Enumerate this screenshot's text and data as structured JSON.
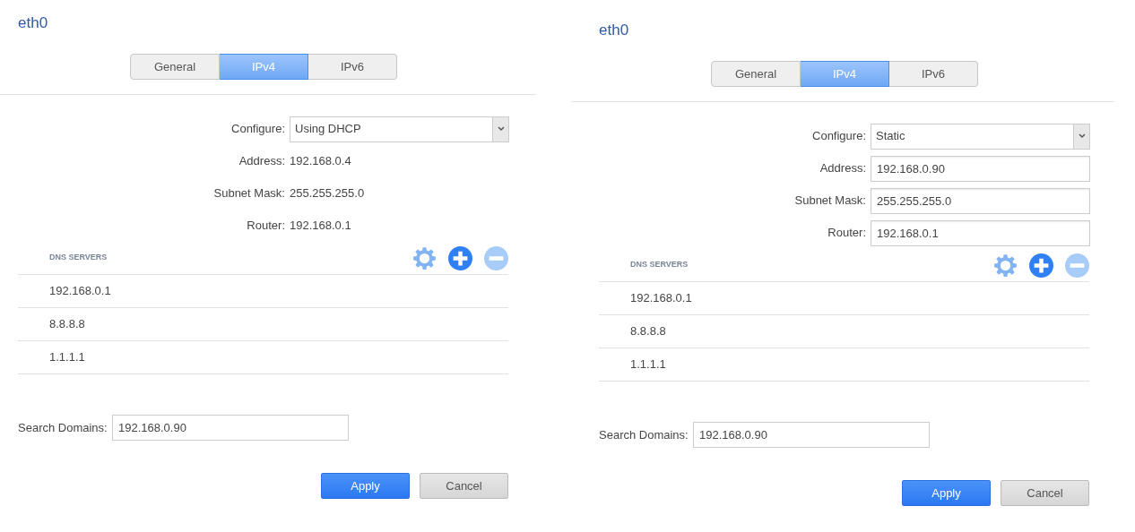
{
  "panels": [
    {
      "title": "eth0",
      "tabs": [
        {
          "label": "General",
          "selected": false
        },
        {
          "label": "IPv4",
          "selected": true
        },
        {
          "label": "IPv6",
          "selected": false
        }
      ],
      "configure": {
        "label": "Configure:",
        "value": "Using DHCP"
      },
      "fields": [
        {
          "label": "Address:",
          "value": "192.168.0.4",
          "kind": "text"
        },
        {
          "label": "Subnet Mask:",
          "value": "255.255.255.0",
          "kind": "text"
        },
        {
          "label": "Router:",
          "value": "192.168.0.1",
          "kind": "text"
        }
      ],
      "dns": {
        "heading": "DNS SERVERS",
        "servers": [
          "192.168.0.1",
          "8.8.8.8",
          "1.1.1.1"
        ]
      },
      "search_domains": {
        "label": "Search Domains:",
        "value": "192.168.0.90"
      },
      "buttons": [
        {
          "label": "Apply",
          "kind": "primary"
        },
        {
          "label": "Cancel",
          "kind": "secondary"
        }
      ]
    },
    {
      "title": "eth0",
      "tabs": [
        {
          "label": "General",
          "selected": false
        },
        {
          "label": "IPv4",
          "selected": true
        },
        {
          "label": "IPv6",
          "selected": false
        }
      ],
      "configure": {
        "label": "Configure:",
        "value": "Static"
      },
      "fields": [
        {
          "label": "Address:",
          "value": "192.168.0.90",
          "kind": "input"
        },
        {
          "label": "Subnet Mask:",
          "value": "255.255.255.0",
          "kind": "input"
        },
        {
          "label": "Router:",
          "value": "192.168.0.1",
          "kind": "input"
        }
      ],
      "dns": {
        "heading": "DNS SERVERS",
        "servers": [
          "192.168.0.1",
          "8.8.8.8",
          "1.1.1.1"
        ]
      },
      "search_domains": {
        "label": "Search Domains:",
        "value": "192.168.0.90"
      },
      "buttons": [
        {
          "label": "Apply",
          "kind": "primary"
        },
        {
          "label": "Cancel",
          "kind": "secondary"
        }
      ]
    }
  ]
}
